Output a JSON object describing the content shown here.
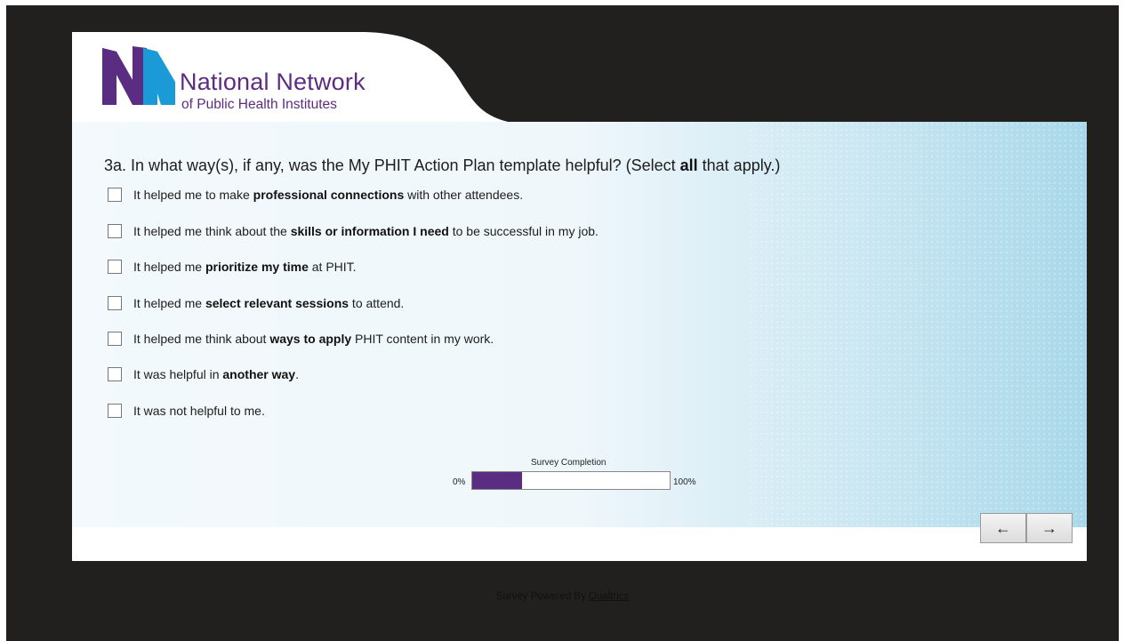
{
  "logo": {
    "line1": "National Network",
    "line2": "of Public Health Institutes"
  },
  "question": {
    "prefix": "3a. In what way(s), if any, was the My PHIT Action Plan template helpful? (Select ",
    "bold": "all",
    "suffix": " that apply.)"
  },
  "choices": [
    {
      "pre": "It helped me to make ",
      "bold": "professional connections",
      "post": " with other attendees."
    },
    {
      "pre": "It helped me think about the ",
      "bold": "skills or information I need",
      "post": " to be successful in my job."
    },
    {
      "pre": "It helped me ",
      "bold": "prioritize my time",
      "post": " at PHIT."
    },
    {
      "pre": "It helped me ",
      "bold": "select relevant sessions",
      "post": " to attend."
    },
    {
      "pre": "It helped me think about ",
      "bold": "ways to apply",
      "post": " PHIT content in my work."
    },
    {
      "pre": "It was helpful in ",
      "bold": "another way",
      "post": "."
    },
    {
      "pre": "It was not helpful to me.",
      "bold": "",
      "post": ""
    }
  ],
  "progress": {
    "label": "Survey Completion",
    "min_label": "0%",
    "max_label": "100%",
    "fraction": 0.25,
    "fill_color": "#5b2d82"
  },
  "nav": {
    "back_label": "←",
    "next_label": "→"
  },
  "footer": {
    "text": "Survey Powered By ",
    "link": "Qualtrics"
  },
  "colors": {
    "brand_purple": "#5b2d82",
    "brand_blue": "#1a9ad6",
    "frame": "#221f1f"
  }
}
